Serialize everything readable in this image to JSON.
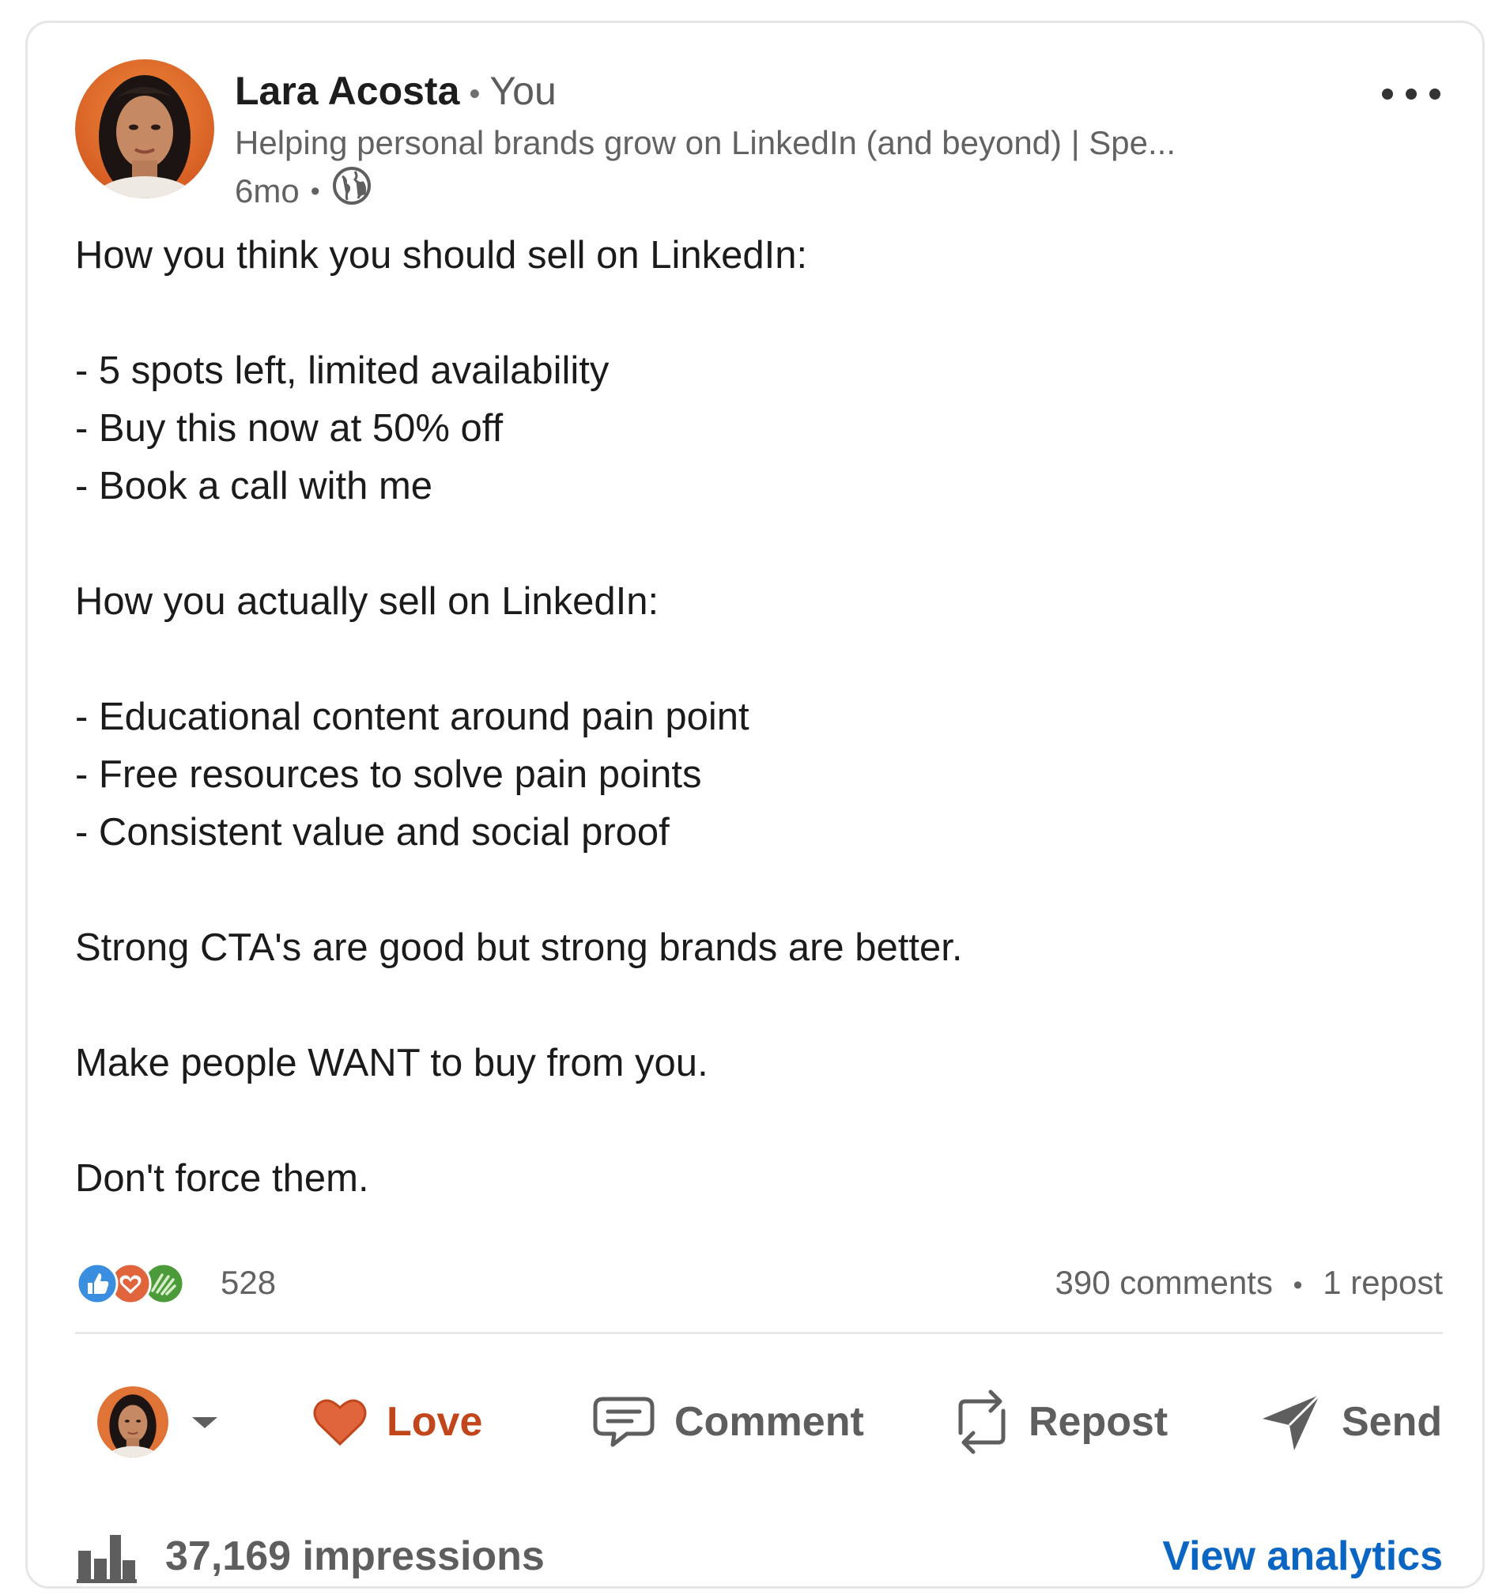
{
  "author": {
    "name": "Lara Acosta",
    "separator": "•",
    "relation": "You",
    "headline": "Helping personal brands grow on LinkedIn (and beyond) | Spe...",
    "time": "6mo",
    "meta_separator": "•",
    "visibility_icon": "globe-icon"
  },
  "menu": {
    "icon": "more-horizontal-icon"
  },
  "post": {
    "lines": [
      "How you think you should sell on LinkedIn:",
      "",
      "- 5 spots left, limited availability",
      "- Buy this now at 50% off",
      "- Book a call with me",
      "",
      "How you actually sell on LinkedIn:",
      "",
      "- Educational content around pain point",
      "- Free resources to solve pain points",
      "- Consistent value and social proof",
      "",
      "Strong CTA's are good but strong brands are better.",
      "",
      "Make people WANT to buy from you.",
      "",
      "Don't force them."
    ]
  },
  "social": {
    "reaction_icons": [
      "like-icon",
      "love-icon",
      "support-icon"
    ],
    "reactions": "528",
    "comments": "390 comments",
    "separator": "•",
    "reposts": "1 repost"
  },
  "actions": {
    "love_label": "Love",
    "comment_label": "Comment",
    "repost_label": "Repost",
    "send_label": "Send"
  },
  "footer": {
    "impressions": "37,169 impressions",
    "view_analytics": "View analytics"
  },
  "colors": {
    "accent_blue": "#0a66c2",
    "love": "#e0643c",
    "love_text": "#c2461b",
    "muted_text": "#626262",
    "border": "#e6e6e6"
  }
}
